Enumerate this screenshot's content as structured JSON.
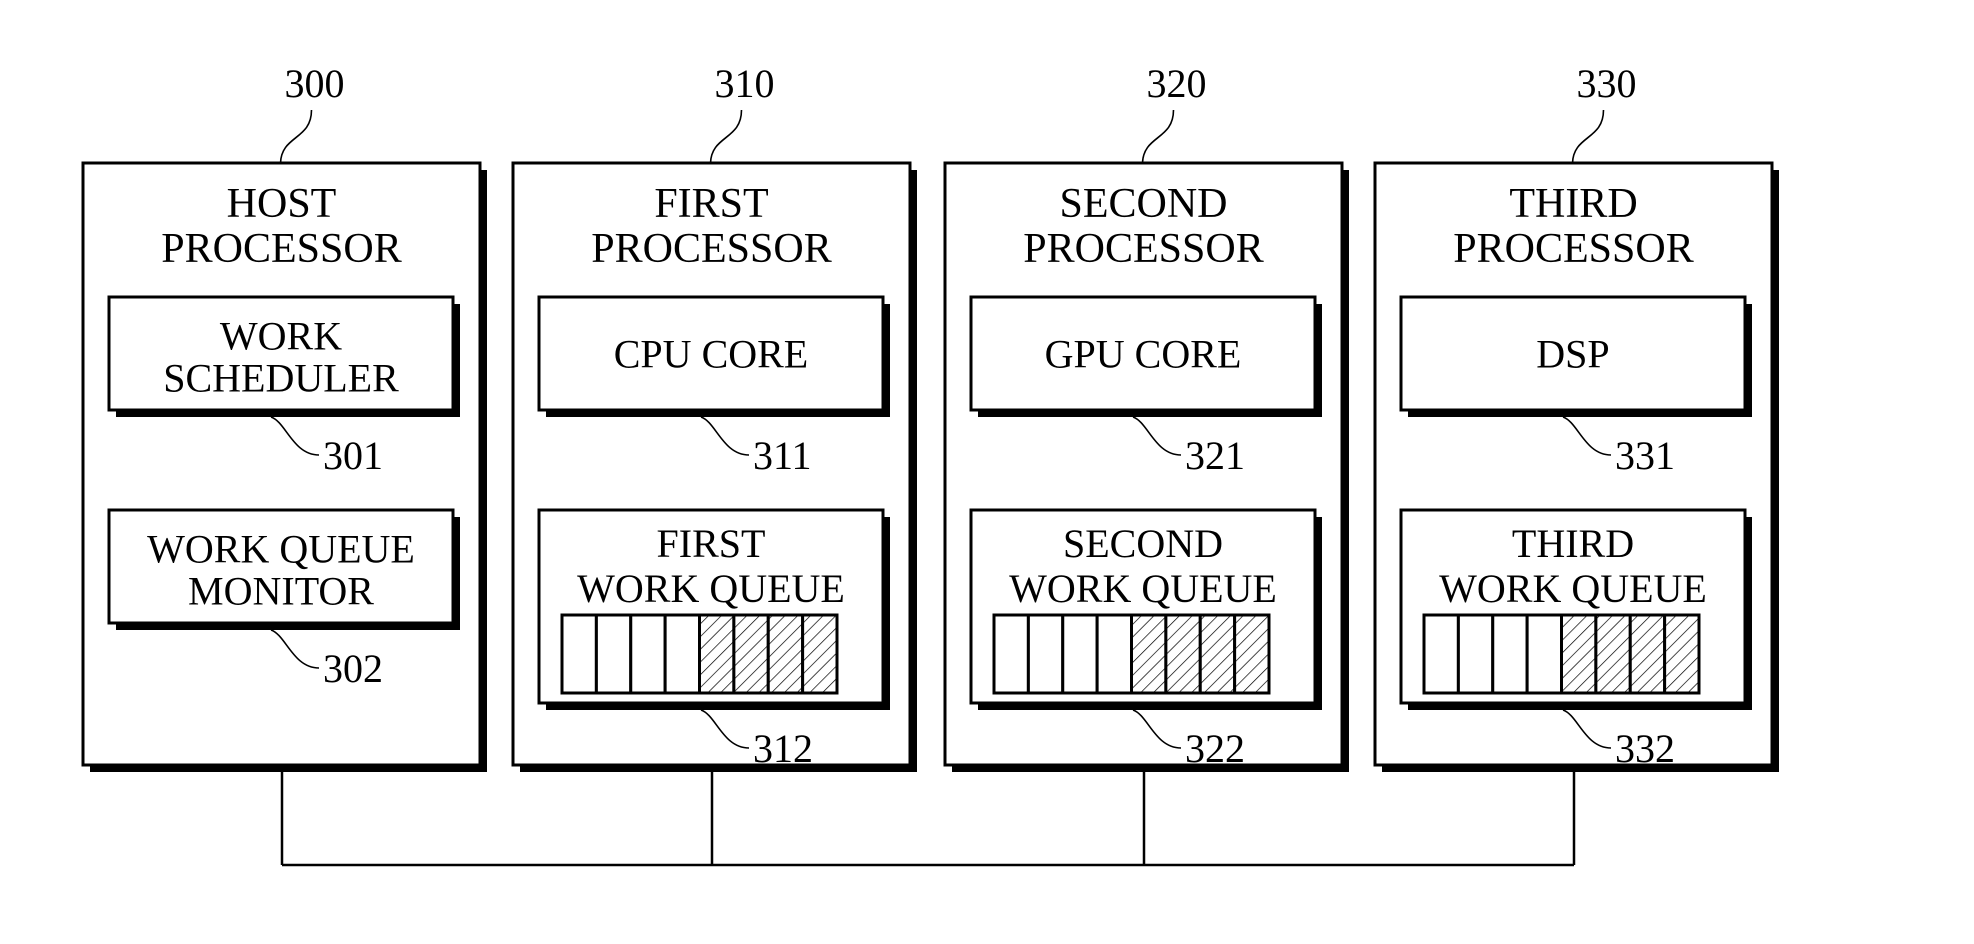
{
  "figure": {
    "processors": [
      {
        "ref": "300",
        "title": [
          "HOST",
          "PROCESSOR"
        ],
        "components": [
          {
            "ref": "301",
            "label": [
              "WORK",
              "SCHEDULER"
            ],
            "type": "unit"
          },
          {
            "ref": "302",
            "label": [
              "WORK QUEUE",
              "MONITOR"
            ],
            "type": "unit"
          }
        ]
      },
      {
        "ref": "310",
        "title": [
          "FIRST",
          "PROCESSOR"
        ],
        "components": [
          {
            "ref": "311",
            "label": [
              "CPU CORE"
            ],
            "type": "unit"
          },
          {
            "ref": "312",
            "label": [
              "FIRST",
              "WORK QUEUE"
            ],
            "type": "queue",
            "slots_total": 8,
            "slots_filled": 4
          }
        ]
      },
      {
        "ref": "320",
        "title": [
          "SECOND",
          "PROCESSOR"
        ],
        "components": [
          {
            "ref": "321",
            "label": [
              "GPU CORE"
            ],
            "type": "unit"
          },
          {
            "ref": "322",
            "label": [
              "SECOND",
              "WORK QUEUE"
            ],
            "type": "queue",
            "slots_total": 8,
            "slots_filled": 4
          }
        ]
      },
      {
        "ref": "330",
        "title": [
          "THIRD",
          "PROCESSOR"
        ],
        "components": [
          {
            "ref": "331",
            "label": [
              "DSP"
            ],
            "type": "unit"
          },
          {
            "ref": "332",
            "label": [
              "THIRD",
              "WORK QUEUE"
            ],
            "type": "queue",
            "slots_total": 8,
            "slots_filled": 4
          }
        ]
      }
    ],
    "bus": {
      "connects": [
        "300",
        "310",
        "320",
        "330"
      ]
    },
    "colors": {
      "ink": "#000000",
      "paper": "#ffffff"
    }
  }
}
